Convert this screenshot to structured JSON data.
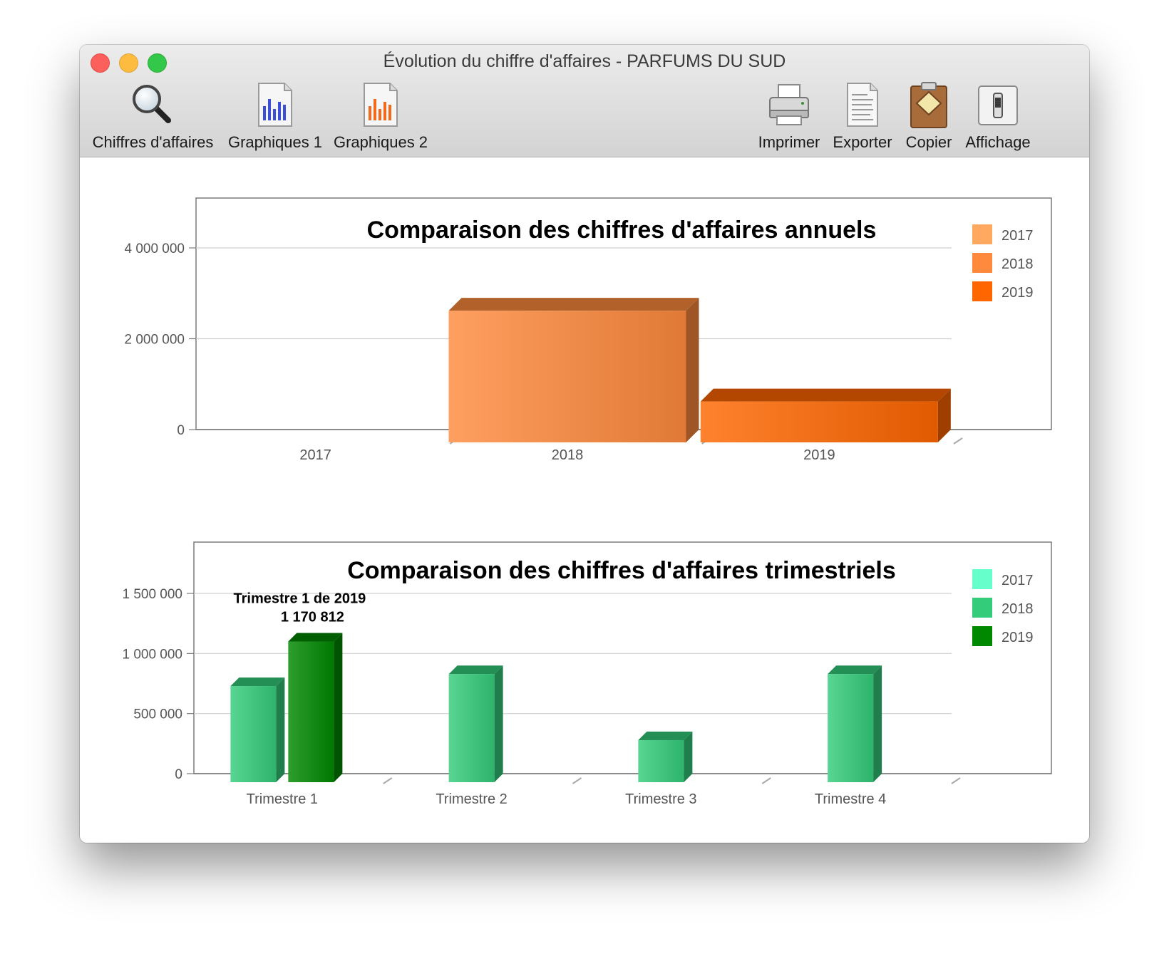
{
  "window": {
    "title": "Évolution du chiffre d'affaires - PARFUMS DU SUD"
  },
  "toolbar": {
    "left": [
      {
        "label": "Chiffres d'affaires",
        "icon": "magnifier-icon"
      },
      {
        "label": "Graphiques 1",
        "icon": "bar-chart-blue-icon"
      },
      {
        "label": "Graphiques 2",
        "icon": "bar-chart-orange-icon"
      }
    ],
    "right": [
      {
        "label": "Imprimer",
        "icon": "printer-icon"
      },
      {
        "label": "Exporter",
        "icon": "export-document-icon"
      },
      {
        "label": "Copier",
        "icon": "clipboard-icon"
      },
      {
        "label": "Affichage",
        "icon": "toggle-switch-icon"
      }
    ]
  },
  "chart_data": [
    {
      "type": "bar",
      "title": "Comparaison des chiffres d'affaires annuels",
      "categories": [
        "2017",
        "2018",
        "2019"
      ],
      "series": [
        {
          "name": "2017",
          "color": "#ffa860",
          "values": [
            0,
            null,
            null
          ]
        },
        {
          "name": "2018",
          "color": "#ff8a3d",
          "values": [
            null,
            2900000,
            null
          ]
        },
        {
          "name": "2019",
          "color": "#ff6600",
          "values": [
            null,
            null,
            900000
          ]
        }
      ],
      "yticks": [
        "0",
        "2 000 000",
        "4 000 000"
      ],
      "ytick_values": [
        0,
        2000000,
        4000000
      ],
      "ylim": [
        0,
        4000000
      ],
      "legend": "right",
      "grid": true
    },
    {
      "type": "bar",
      "title": "Comparaison des chiffres d'affaires trimestriels",
      "categories": [
        "Trimestre 1",
        "Trimestre 2",
        "Trimestre 3",
        "Trimestre 4"
      ],
      "series": [
        {
          "name": "2017",
          "color": "#66ffcc",
          "values": [
            null,
            null,
            null,
            null
          ]
        },
        {
          "name": "2018",
          "color": "#33cc7a",
          "values": [
            800000,
            900000,
            350000,
            900000
          ]
        },
        {
          "name": "2019",
          "color": "#008800",
          "values": [
            1170812,
            null,
            null,
            null
          ]
        }
      ],
      "yticks": [
        "0",
        "500 000",
        "1 000 000",
        "1 500 000"
      ],
      "ytick_values": [
        0,
        500000,
        1000000,
        1500000
      ],
      "ylim": [
        0,
        1500000
      ],
      "legend": "right",
      "grid": true,
      "annotation": {
        "line1": "Trimestre 1 de 2019",
        "line2": "1 170 812",
        "category": 0,
        "series": 2
      }
    }
  ]
}
